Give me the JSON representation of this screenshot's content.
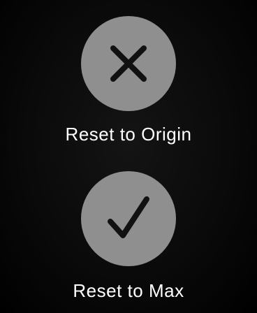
{
  "actions": [
    {
      "label": "Reset to Origin",
      "icon": "close-icon",
      "button_color": "#8f8f8f",
      "icon_color": "#111111"
    },
    {
      "label": "Reset to Max",
      "icon": "checkmark-icon",
      "button_color": "#8f8f8f",
      "icon_color": "#111111"
    }
  ]
}
